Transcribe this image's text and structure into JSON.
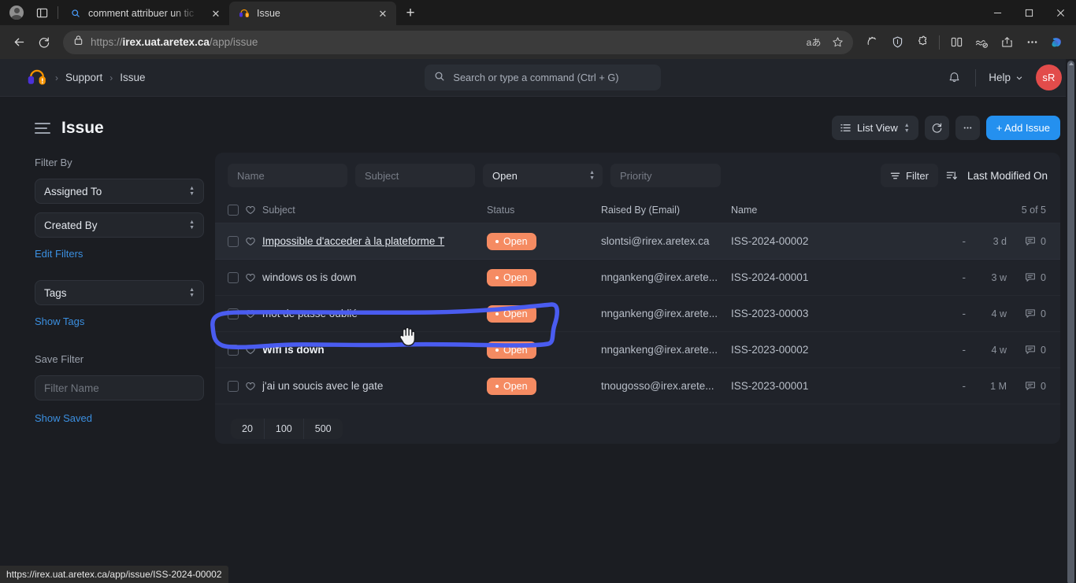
{
  "browser": {
    "tabs": [
      {
        "title": "comment attribuer un tic",
        "favicon": "search-icon",
        "active": false
      },
      {
        "title": "Issue",
        "favicon": "support-logo-icon",
        "active": true
      }
    ],
    "newtab_label": "+",
    "url_prefix": "https://",
    "url_host": "irex.uat.aretex.ca",
    "url_path": "/app/issue",
    "omnibox_icons": [
      "translate-icon",
      "favorite-star-icon"
    ],
    "toolbar_icons": [
      "extension-games-icon",
      "shield-icon",
      "extensions-puzzle-icon",
      "split-screen-icon",
      "collections-icon",
      "share-icon",
      "more-options-icon",
      "copilot-icon"
    ],
    "window_controls": [
      "minimize",
      "maximize",
      "close"
    ]
  },
  "statusbar": {
    "url": "https://irex.uat.aretex.ca/app/issue/ISS-2024-00002"
  },
  "header": {
    "logo": "support-logo-icon",
    "breadcrumbs": [
      "Support",
      "Issue"
    ],
    "search_placeholder": "Search or type a command (Ctrl + G)",
    "bell": "notification-bell-icon",
    "help_label": "Help",
    "avatar_initials": "sR",
    "avatar_color": "#e24c4b"
  },
  "page": {
    "title": "Issue",
    "view_label": "List View",
    "refresh": "refresh-icon",
    "more": "more-menu-icon",
    "add_label": "+ Add Issue",
    "add_color": "#2490ef"
  },
  "sidebar": {
    "filter_by_label": "Filter By",
    "filters": [
      {
        "label": "Assigned To"
      },
      {
        "label": "Created By"
      },
      {
        "label": "Tags"
      }
    ],
    "edit_filters_label": "Edit Filters",
    "show_tags_label": "Show Tags",
    "save_filter_label": "Save Filter",
    "filter_name_placeholder": "Filter Name",
    "show_saved_label": "Show Saved"
  },
  "filters": {
    "name_placeholder": "Name",
    "subject_placeholder": "Subject",
    "status_value": "Open",
    "priority_placeholder": "Priority",
    "filter_button": "Filter",
    "sort_label": "Last Modified On"
  },
  "table": {
    "columns": [
      "Subject",
      "Status",
      "Raised By (Email)",
      "Name"
    ],
    "count_label": "5 of 5",
    "status_color": "#f58b62",
    "rows": [
      {
        "subject": "Impossible d'acceder à la plateforme T",
        "status": "Open",
        "email": "slontsi@rirex.aretex.ca",
        "name": "ISS-2024-00002",
        "assignee": "-",
        "age": "3 d",
        "comments": "0",
        "selected": true,
        "bold": false,
        "underline": true
      },
      {
        "subject": "windows os is down",
        "status": "Open",
        "email": "nngankeng@irex.arete...",
        "name": "ISS-2024-00001",
        "assignee": "-",
        "age": "3 w",
        "comments": "0",
        "selected": false,
        "bold": false,
        "underline": false
      },
      {
        "subject": "mot de passe oublié",
        "status": "Open",
        "email": "nngankeng@irex.arete...",
        "name": "ISS-2023-00003",
        "assignee": "-",
        "age": "4 w",
        "comments": "0",
        "selected": false,
        "bold": false,
        "underline": false
      },
      {
        "subject": "Wifi is down",
        "status": "Open",
        "email": "nngankeng@irex.arete...",
        "name": "ISS-2023-00002",
        "assignee": "-",
        "age": "4 w",
        "comments": "0",
        "selected": false,
        "bold": true,
        "underline": false
      },
      {
        "subject": "j'ai un soucis avec le gate",
        "status": "Open",
        "email": "tnougosso@irex.arete...",
        "name": "ISS-2023-00001",
        "assignee": "-",
        "age": "1 M",
        "comments": "0",
        "selected": false,
        "bold": false,
        "underline": false
      }
    ]
  },
  "pagination": {
    "options": [
      "20",
      "100",
      "500"
    ]
  },
  "annotation": {
    "shape": "hand-drawn-ellipse",
    "color": "#4a5cf0",
    "target": "first-table-row"
  }
}
